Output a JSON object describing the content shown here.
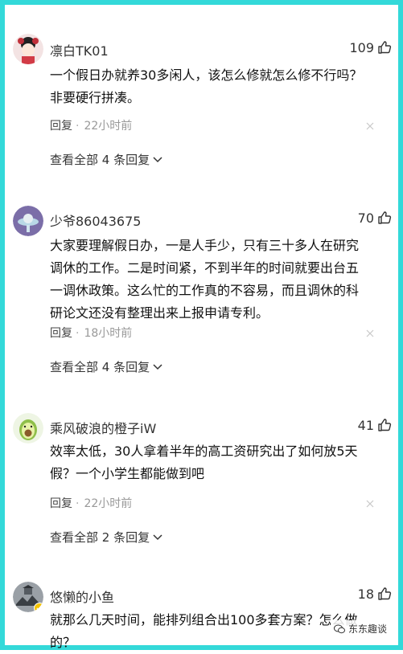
{
  "comments": [
    {
      "username": "凛白TK01",
      "likes": "109",
      "text": "一个假日办就养30多闲人，该怎么修就怎么修不行吗？非要硬行拼凑。",
      "reply_label": "回复",
      "separator": "·",
      "time": "22小时前",
      "view_replies": "查看全部 4 条回复"
    },
    {
      "username": "少爷86043675",
      "likes": "70",
      "text": "大家要理解假日办，一是人手少，只有三十多人在研究调休的工作。二是时间紧，不到半年的时间就要出台五一调休政策。这么忙的工作真的不容易，而且调休的科研论文还没有整理出来上报申请专利。",
      "reply_label": "回复",
      "separator": "·",
      "time": "18小时前",
      "view_replies": "查看全部 4 条回复"
    },
    {
      "username": "乘风破浪的橙子iW",
      "likes": "41",
      "text": "效率太低，30人拿着半年的高工资研究出了如何放5天假？一个小学生都能做到吧",
      "reply_label": "回复",
      "separator": "·",
      "time": "22小时前",
      "view_replies": "查看全部 2 条回复"
    },
    {
      "username": "悠懒的小鱼",
      "likes": "18",
      "text": "就那么几天时间，能排列组合出100多套方案？怎么做的？"
    }
  ],
  "watermark": "东东趣谈",
  "colors": {
    "border": "#33d9d9",
    "time": "#999999"
  }
}
